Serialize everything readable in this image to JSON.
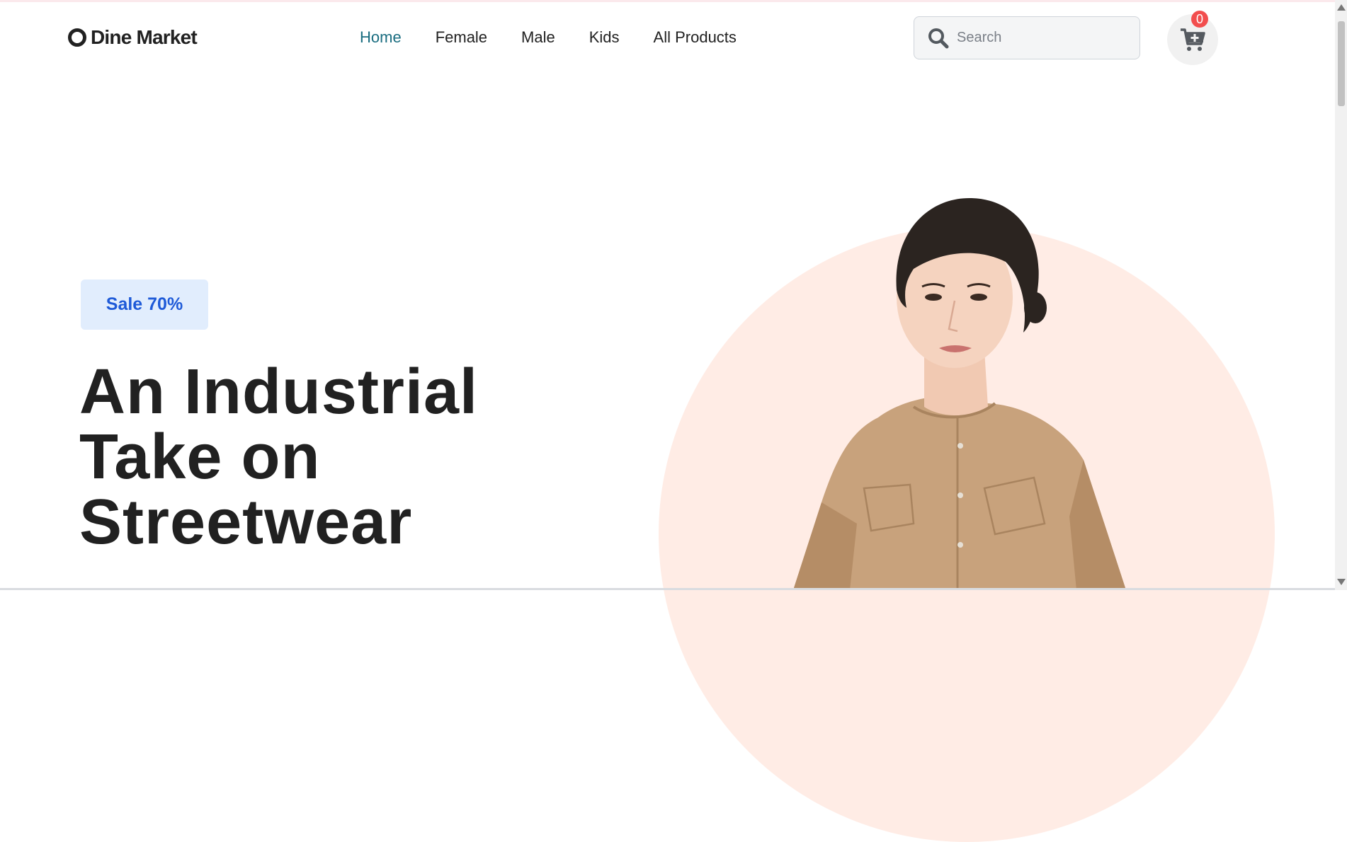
{
  "brand": {
    "name": "Dine Market"
  },
  "nav": {
    "items": [
      {
        "label": "Home",
        "active": true
      },
      {
        "label": "Female",
        "active": false
      },
      {
        "label": "Male",
        "active": false
      },
      {
        "label": "Kids",
        "active": false
      },
      {
        "label": "All Products",
        "active": false
      }
    ]
  },
  "search": {
    "placeholder": "Search",
    "value": ""
  },
  "cart": {
    "count": "0",
    "icon": "cart-plus-icon"
  },
  "hero": {
    "badge": "Sale 70%",
    "headline": "An Industrial Take on Streetwear",
    "image": "model-in-tan-shirt-dress"
  },
  "colors": {
    "accent_active_nav": "#1a6d80",
    "badge_bg": "#e1edfd",
    "badge_text": "#1e5ad8",
    "hero_circle": "#ffece5",
    "cart_badge": "#f24e4e"
  }
}
